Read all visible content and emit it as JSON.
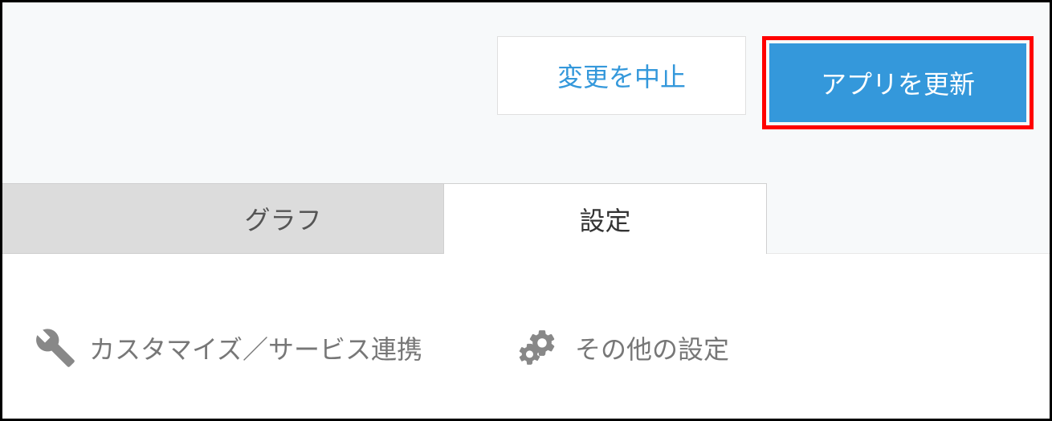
{
  "header": {
    "cancel_label": "変更を中止",
    "update_label": "アプリを更新"
  },
  "tabs": {
    "graph_label": "グラフ",
    "settings_label": "設定"
  },
  "content": {
    "customize_label": "カスタマイズ／サービス連携",
    "other_settings_label": "その他の設定"
  }
}
